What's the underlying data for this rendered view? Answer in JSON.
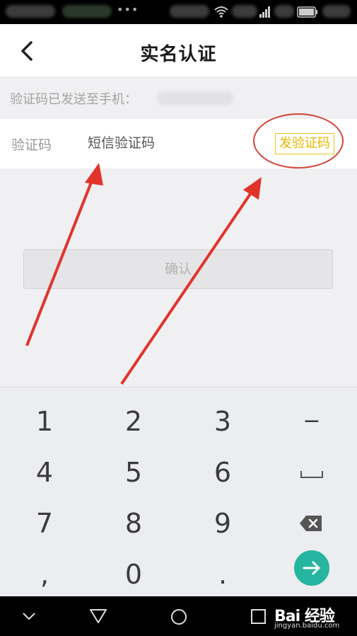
{
  "header": {
    "title": "实名认证"
  },
  "notice": {
    "text": "验证码已发送至手机："
  },
  "code_row": {
    "label": "验证码",
    "placeholder": "短信验证码",
    "send_button": "发验证码"
  },
  "confirm_button": "确认",
  "keyboard": {
    "rows": [
      [
        "1",
        "2",
        "3",
        "−"
      ],
      [
        "4",
        "5",
        "6",
        "space"
      ],
      [
        "7",
        "8",
        "9",
        "backspace"
      ],
      [
        ",",
        "0",
        ".",
        "go"
      ]
    ],
    "k1": "1",
    "k2": "2",
    "k3": "3",
    "minus": "−",
    "k4": "4",
    "k5": "5",
    "k6": "6",
    "k7": "7",
    "k8": "8",
    "k9": "9",
    "comma": ",",
    "k0": "0",
    "dot": "."
  },
  "watermark": {
    "main": "Bai 经验",
    "sub": "jingyan.baidu.com"
  },
  "colors": {
    "accent_yellow": "#e8b800",
    "annotation_red": "#d4453a",
    "go_teal": "#26b5a0"
  },
  "icons": [
    "wifi-icon",
    "signal-icon",
    "battery-icon",
    "back-icon",
    "backspace-icon",
    "enter-arrow-icon",
    "nav-down-icon",
    "nav-back-icon",
    "nav-home-icon",
    "nav-recent-icon"
  ]
}
